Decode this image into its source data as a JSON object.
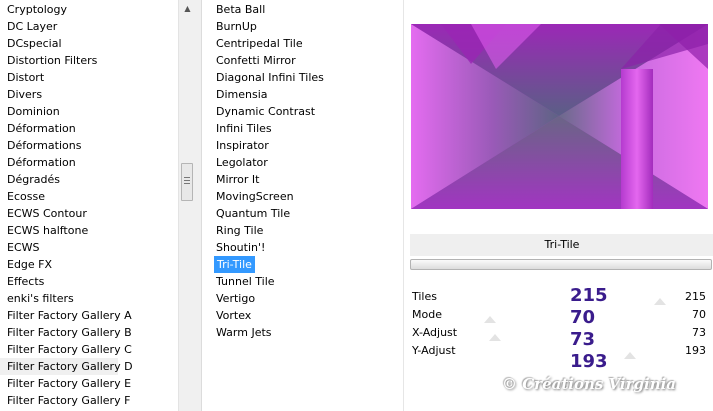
{
  "categories": {
    "items": [
      "Cryptology",
      "DC Layer",
      "DCspecial",
      "Distortion Filters",
      "Distort",
      "Divers",
      "Dominion",
      "Déformation",
      "Déformations",
      "Déformation",
      "Dégradés",
      "Ecosse",
      "ECWS Contour",
      "ECWS halftone",
      "ECWS",
      "Edge FX",
      "Effects",
      "enki's filters",
      "Filter Factory Gallery A",
      "Filter Factory Gallery B",
      "Filter Factory Gallery C",
      "Filter Factory Gallery D",
      "Filter Factory Gallery E",
      "Filter Factory Gallery F"
    ],
    "selected": "Filter Factory Gallery D"
  },
  "filters": {
    "items": [
      "Beta Ball",
      "BurnUp",
      "Centripedal Tile",
      "Confetti Mirror",
      "Diagonal Infini Tiles",
      "Dimensia",
      "Dynamic Contrast",
      "Infini Tiles",
      "Inspirator",
      "Legolator",
      "Mirror It",
      "MovingScreen",
      "Quantum Tile",
      "Ring Tile",
      "Shoutin'!",
      "Tri-Tile",
      "Tunnel Tile",
      "Vertigo",
      "Vortex",
      "Warm Jets"
    ],
    "selected": "Tri-Tile"
  },
  "scrollbar": {
    "up_icon": "▲"
  },
  "filter_title": "Tri-Tile",
  "params": [
    {
      "label": "Tiles",
      "value": "215",
      "big": "215"
    },
    {
      "label": "Mode",
      "value": "70",
      "big": "70"
    },
    {
      "label": "X-Adjust",
      "value": "73",
      "big": "73"
    },
    {
      "label": "Y-Adjust",
      "value": "193",
      "big": "193"
    }
  ],
  "watermark": "© Créations Virginia",
  "colors": {
    "selection": "#3399ff",
    "big_number": "#3a1c8c"
  }
}
